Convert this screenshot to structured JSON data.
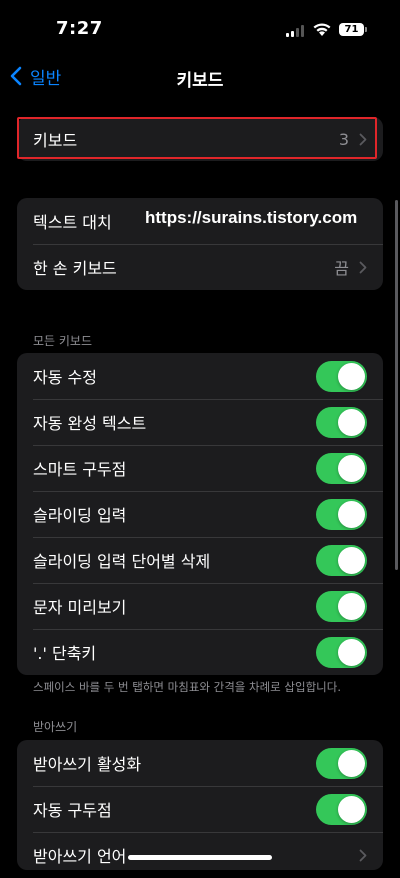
{
  "status": {
    "time": "7:27",
    "battery": "71"
  },
  "nav": {
    "back_label": "일반",
    "title": "키보드"
  },
  "keyboards_row": {
    "label": "키보드",
    "value": "3"
  },
  "text_group": {
    "items": [
      {
        "label": "텍스트 대치"
      },
      {
        "label": "한 손 키보드",
        "value": "끔"
      }
    ]
  },
  "watermark": "https://surains.tistory.com",
  "all_keyboards": {
    "header": "모든 키보드",
    "toggles": [
      {
        "label": "자동 수정",
        "on": true
      },
      {
        "label": "자동 완성 텍스트",
        "on": true
      },
      {
        "label": "스마트 구두점",
        "on": true
      },
      {
        "label": "슬라이딩 입력",
        "on": true
      },
      {
        "label": "슬라이딩 입력 단어별 삭제",
        "on": true
      },
      {
        "label": "문자 미리보기",
        "on": true
      },
      {
        "label": "'.' 단축키",
        "on": true
      }
    ],
    "footer": "스페이스 바를 두 번 탭하면 마침표와 간격을 차례로 삽입합니다."
  },
  "dictation": {
    "header": "받아쓰기",
    "toggles": [
      {
        "label": "받아쓰기 활성화",
        "on": true
      },
      {
        "label": "자동 구두점",
        "on": true
      }
    ],
    "language_label": "받아쓰기 언어"
  },
  "colors": {
    "accent": "#0a84ff",
    "toggle_on": "#34c759",
    "highlight": "#e0262a"
  }
}
